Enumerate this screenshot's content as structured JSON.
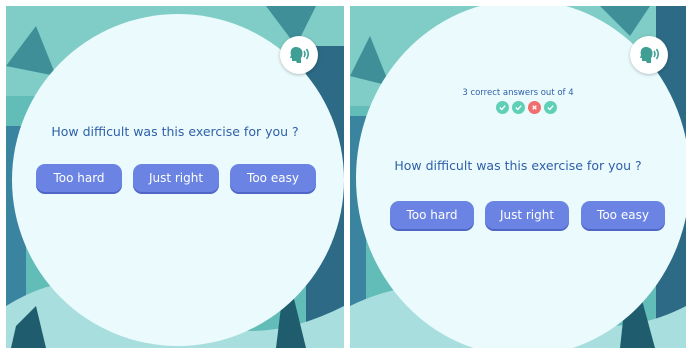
{
  "colors": {
    "accent": "#6b84e3",
    "question_text": "#2f5fa8",
    "correct": "#5fcfb8",
    "incorrect": "#f26d6d",
    "panel_bg": "#ebfbfd"
  },
  "left_screen": {
    "speaker_icon": "speaker-face-icon",
    "question": "How difficult was this exercise for you ?",
    "buttons": {
      "too_hard": "Too hard",
      "just_right": "Just right",
      "too_easy": "Too easy"
    }
  },
  "right_screen": {
    "speaker_icon": "speaker-face-icon",
    "score_text": "3 correct answers out of 4",
    "results": [
      "correct",
      "correct",
      "incorrect",
      "correct"
    ],
    "question": "How difficult was this exercise for you ?",
    "buttons": {
      "too_hard": "Too hard",
      "just_right": "Just right",
      "too_easy": "Too easy"
    }
  }
}
